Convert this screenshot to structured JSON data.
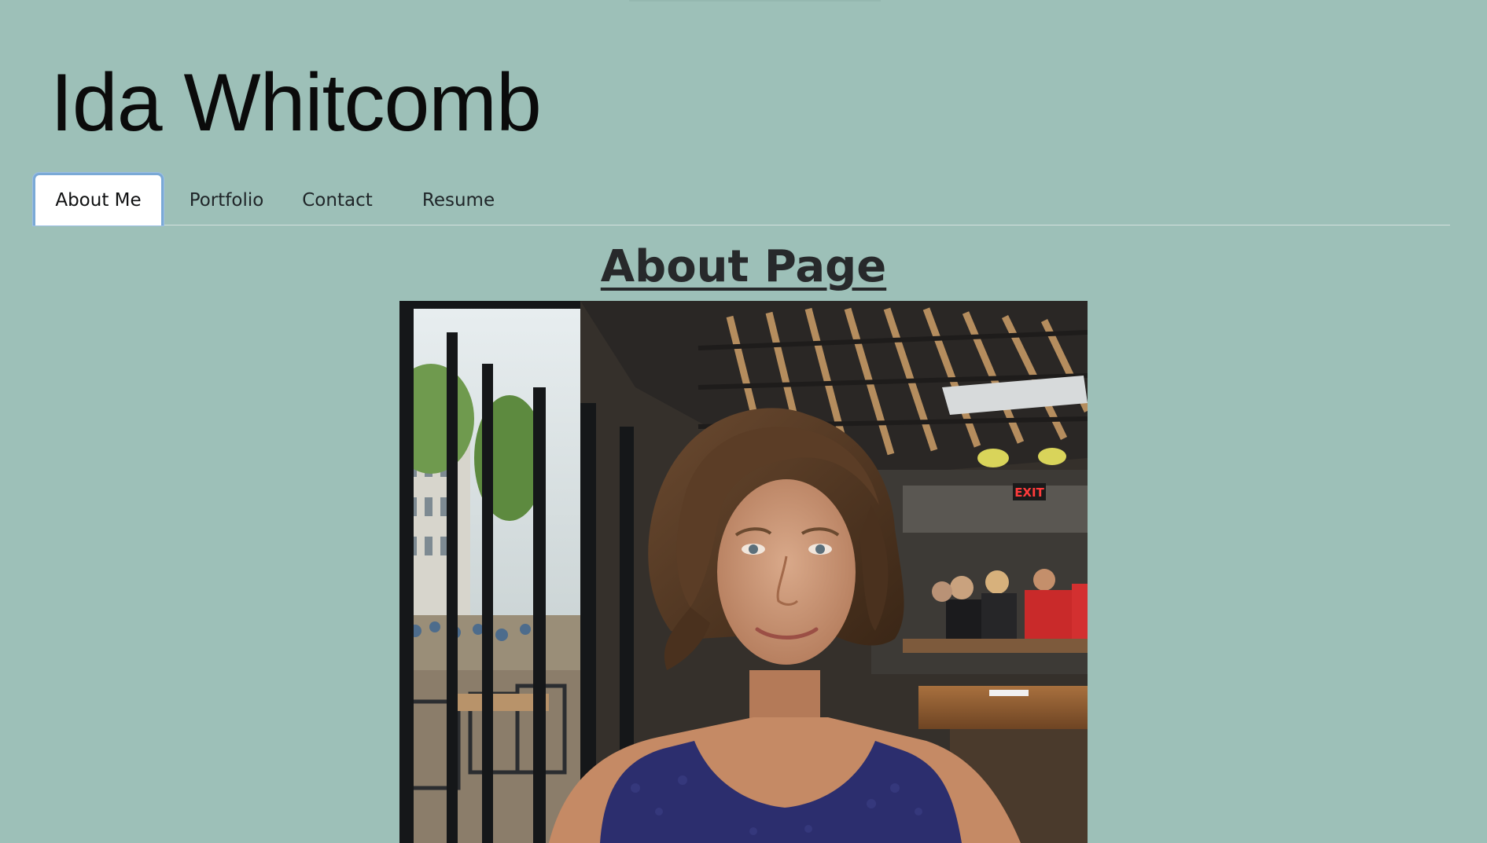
{
  "site": {
    "title": "Ida Whitcomb"
  },
  "nav": {
    "tabs": [
      {
        "label": "About Me",
        "active": true
      },
      {
        "label": "Portfolio",
        "active": false
      },
      {
        "label": "Contact",
        "active": false
      },
      {
        "label": "Resume",
        "active": false
      }
    ]
  },
  "main": {
    "heading": "About Page",
    "photo_sign_text": "EXIT"
  },
  "colors": {
    "page_background": "#9dc0b8",
    "active_tab_border": "#7aa9d6",
    "text": "#0b0b0b"
  }
}
